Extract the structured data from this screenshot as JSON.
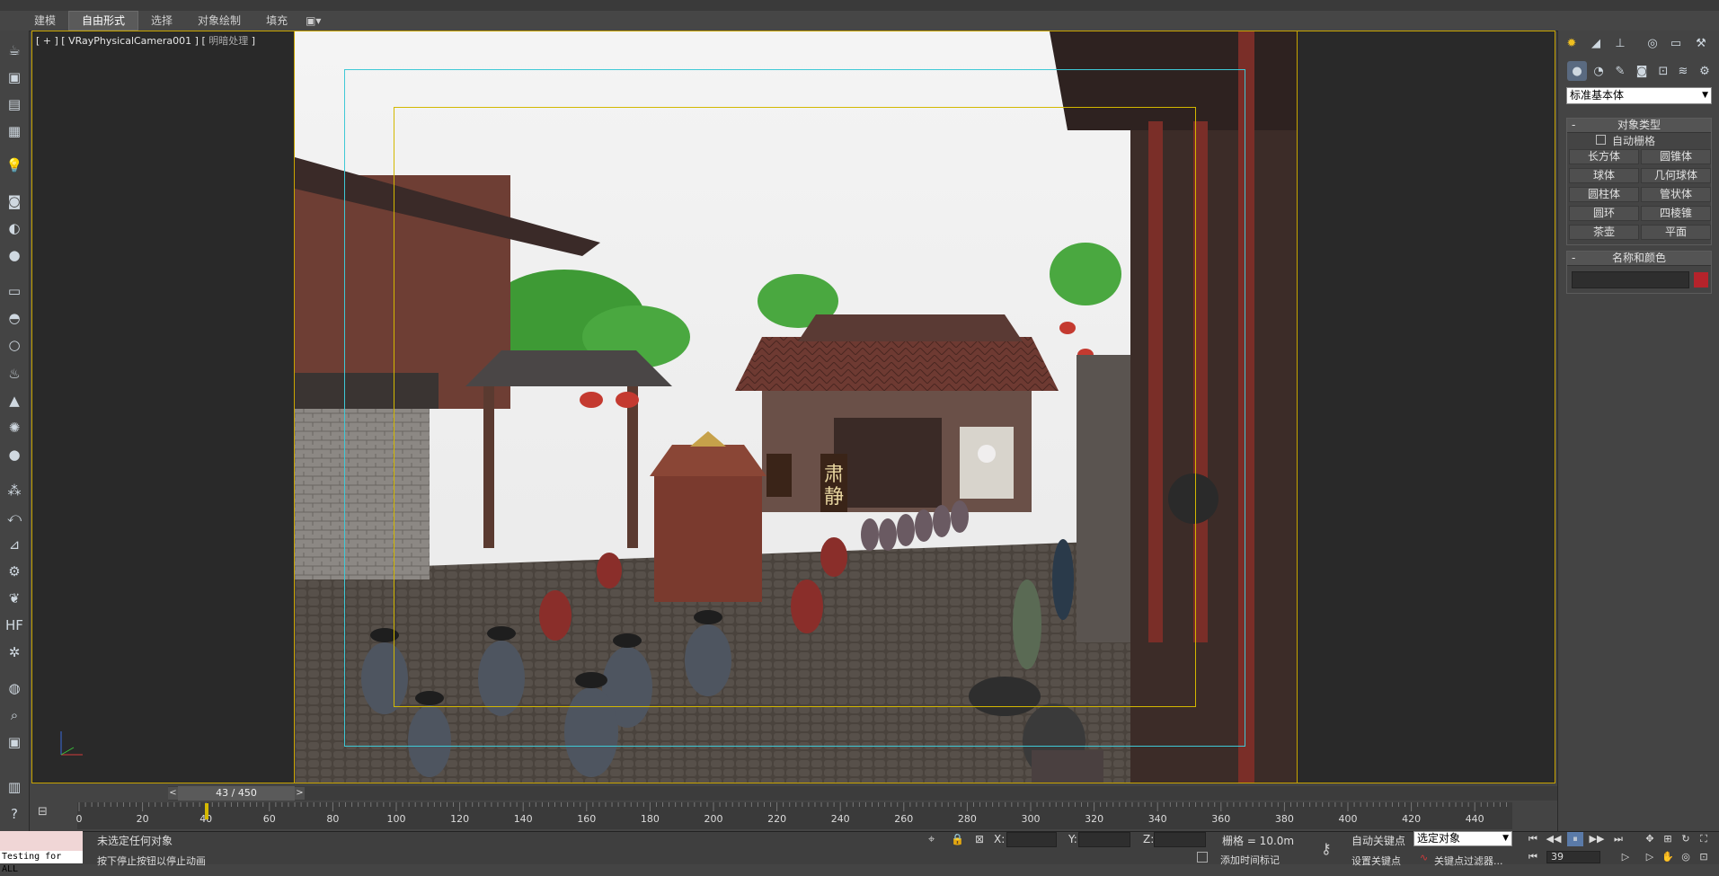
{
  "ribbon": {
    "tabs": [
      {
        "label": "建模",
        "active": false
      },
      {
        "label": "自由形式",
        "active": true
      },
      {
        "label": "选择",
        "active": false
      },
      {
        "label": "对象绘制",
        "active": false
      },
      {
        "label": "填充",
        "active": false
      }
    ]
  },
  "viewport": {
    "label_main": "[ + ] [ VRayPhysicalCamera001 ] [",
    "label_mode": "明暗处理",
    "label_end": "]"
  },
  "command_panel": {
    "category": "标准基本体",
    "object_type_title": "对象类型",
    "auto_grid_label": "自动栅格",
    "object_buttons": [
      "长方体",
      "圆锥体",
      "球体",
      "几何球体",
      "圆柱体",
      "管状体",
      "圆环",
      "四棱锥",
      "茶壶",
      "平面"
    ],
    "name_color_title": "名称和颜色",
    "object_color": "#b5232b"
  },
  "time_slider": {
    "current": 43,
    "total": 450,
    "label": "43 / 450"
  },
  "track_bar": {
    "ticks": [
      "0",
      "20",
      "40",
      "60",
      "80",
      "100",
      "120",
      "140",
      "160",
      "180",
      "200",
      "220",
      "240",
      "260",
      "280",
      "300",
      "320",
      "340",
      "360",
      "380",
      "400",
      "420",
      "440"
    ]
  },
  "status": {
    "selection_msg": "未选定任何对象",
    "prompt_msg": "按下停止按钮以停止动画",
    "x_label": "X:",
    "y_label": "Y:",
    "z_label": "Z:",
    "grid": "栅格 = 10.0m",
    "add_time_tag": "添加时间标记",
    "auto_key": "自动关键点",
    "set_key": "设置关键点",
    "selected_dropdown": "选定对象",
    "key_filters": "关键点过滤器...",
    "current_frame": "39",
    "maxscript_text": "Testing for ALL"
  },
  "colors": {
    "viewport_border": "#c8a400",
    "safe_frame_outer": "#3ec9d6",
    "safe_frame_inner": "#d3b800"
  }
}
